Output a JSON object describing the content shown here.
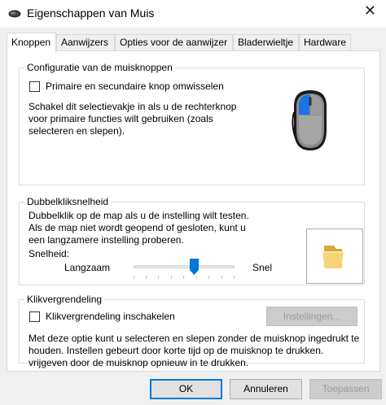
{
  "window": {
    "title": "Eigenschappen van Muis",
    "close_glyph": "✕",
    "icon": "mouse-icon"
  },
  "tabs": [
    {
      "label": "Knoppen",
      "active": true
    },
    {
      "label": "Aanwijzers",
      "active": false
    },
    {
      "label": "Opties voor de aanwijzer",
      "active": false
    },
    {
      "label": "Bladerwieltje",
      "active": false
    },
    {
      "label": "Hardware",
      "active": false
    }
  ],
  "button_config": {
    "legend": "Configuratie van de muisknoppen",
    "checkbox_label": "Primaire en secundaire knop omwisselen",
    "checked": false,
    "description_lines": [
      "Schakel dit selectievakje in als u de rechterknop",
      "voor primaire functies wilt gebruiken (zoals",
      "selecteren en slepen)."
    ],
    "image": "mouse-illustration-icon"
  },
  "double_click": {
    "legend": "Dubbelkliksnelheid",
    "description_lines": [
      "Dubbelklik op de map als u de instelling wilt testen.",
      "Als de map niet wordt geopend of gesloten, kunt u",
      "een langzamere instelling proberen."
    ],
    "speed_label": "Snelheid:",
    "slow_label": "Langzaam",
    "fast_label": "Snel",
    "slider_value": 0.6,
    "test_folder": "folder-icon"
  },
  "click_lock": {
    "legend": "Klikvergrendeling",
    "checkbox_label": "Klikvergrendeling inschakelen",
    "checked": false,
    "settings_button": "Instellingen...",
    "description_lines": [
      "Met deze optie kunt u selecteren en slepen zonder de muisknop ingedrukt te",
      "houden. Instellen gebeurt door korte tijd op de muisknop te drukken.",
      "vrijgeven door de muisknop opnieuw in te drukken."
    ]
  },
  "footer": {
    "ok": "OK",
    "cancel": "Annuleren",
    "apply": "Toepassen"
  },
  "colors": {
    "accent": "#0078d7",
    "mouse_button": "#1a73e8"
  }
}
